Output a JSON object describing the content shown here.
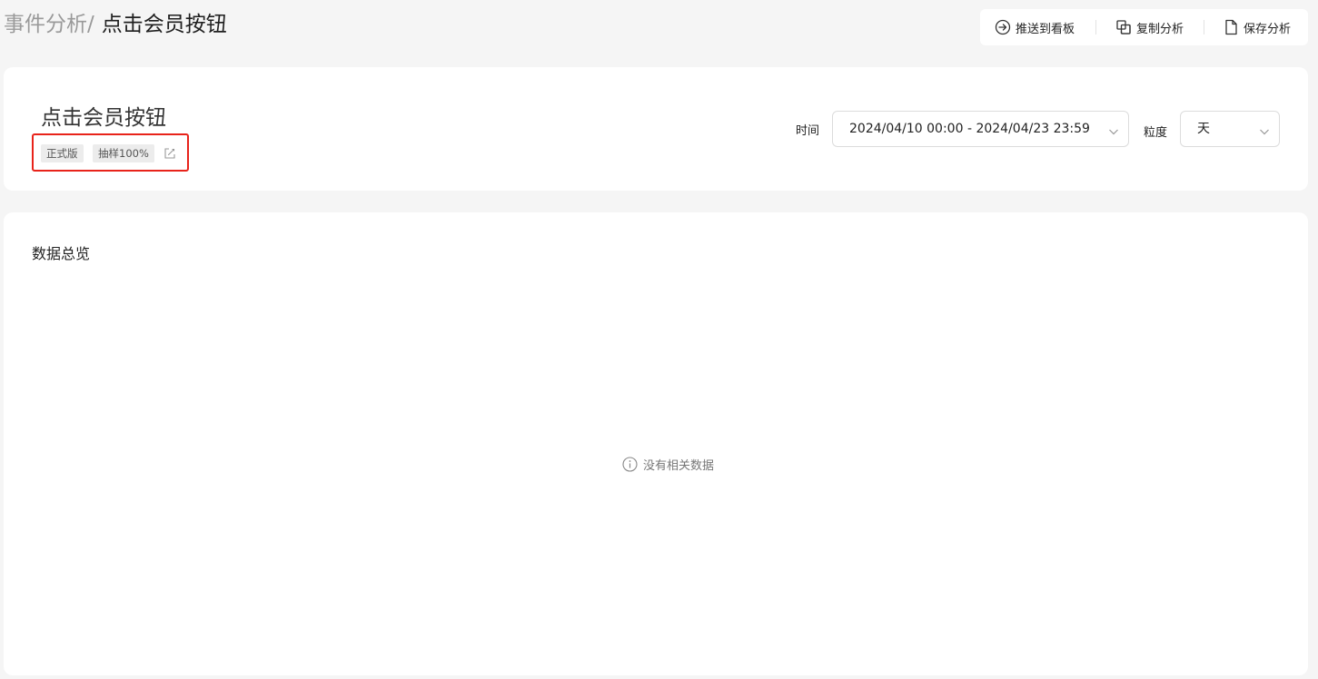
{
  "breadcrumb": {
    "parent": "事件分析",
    "separator": "/",
    "current": "点击会员按钮"
  },
  "toolbar": {
    "push_label": "推送到看板",
    "push_icon": "arrow-circle-right-icon",
    "copy_label": "复制分析",
    "copy_icon": "copy-icon",
    "save_label": "保存分析",
    "save_icon": "document-icon"
  },
  "header": {
    "title": "点击会员按钮",
    "tags": [
      "正式版",
      "抽样100%"
    ],
    "edit_icon": "edit-icon",
    "highlight_color": "#e8231a"
  },
  "filters": {
    "time_label": "时间",
    "time_value": "2024/04/10 00:00 - 2024/04/23 23:59",
    "granularity_label": "粒度",
    "granularity_value": "天"
  },
  "overview": {
    "title": "数据总览",
    "empty_text": "没有相关数据",
    "empty_icon": "info-circle-icon"
  }
}
